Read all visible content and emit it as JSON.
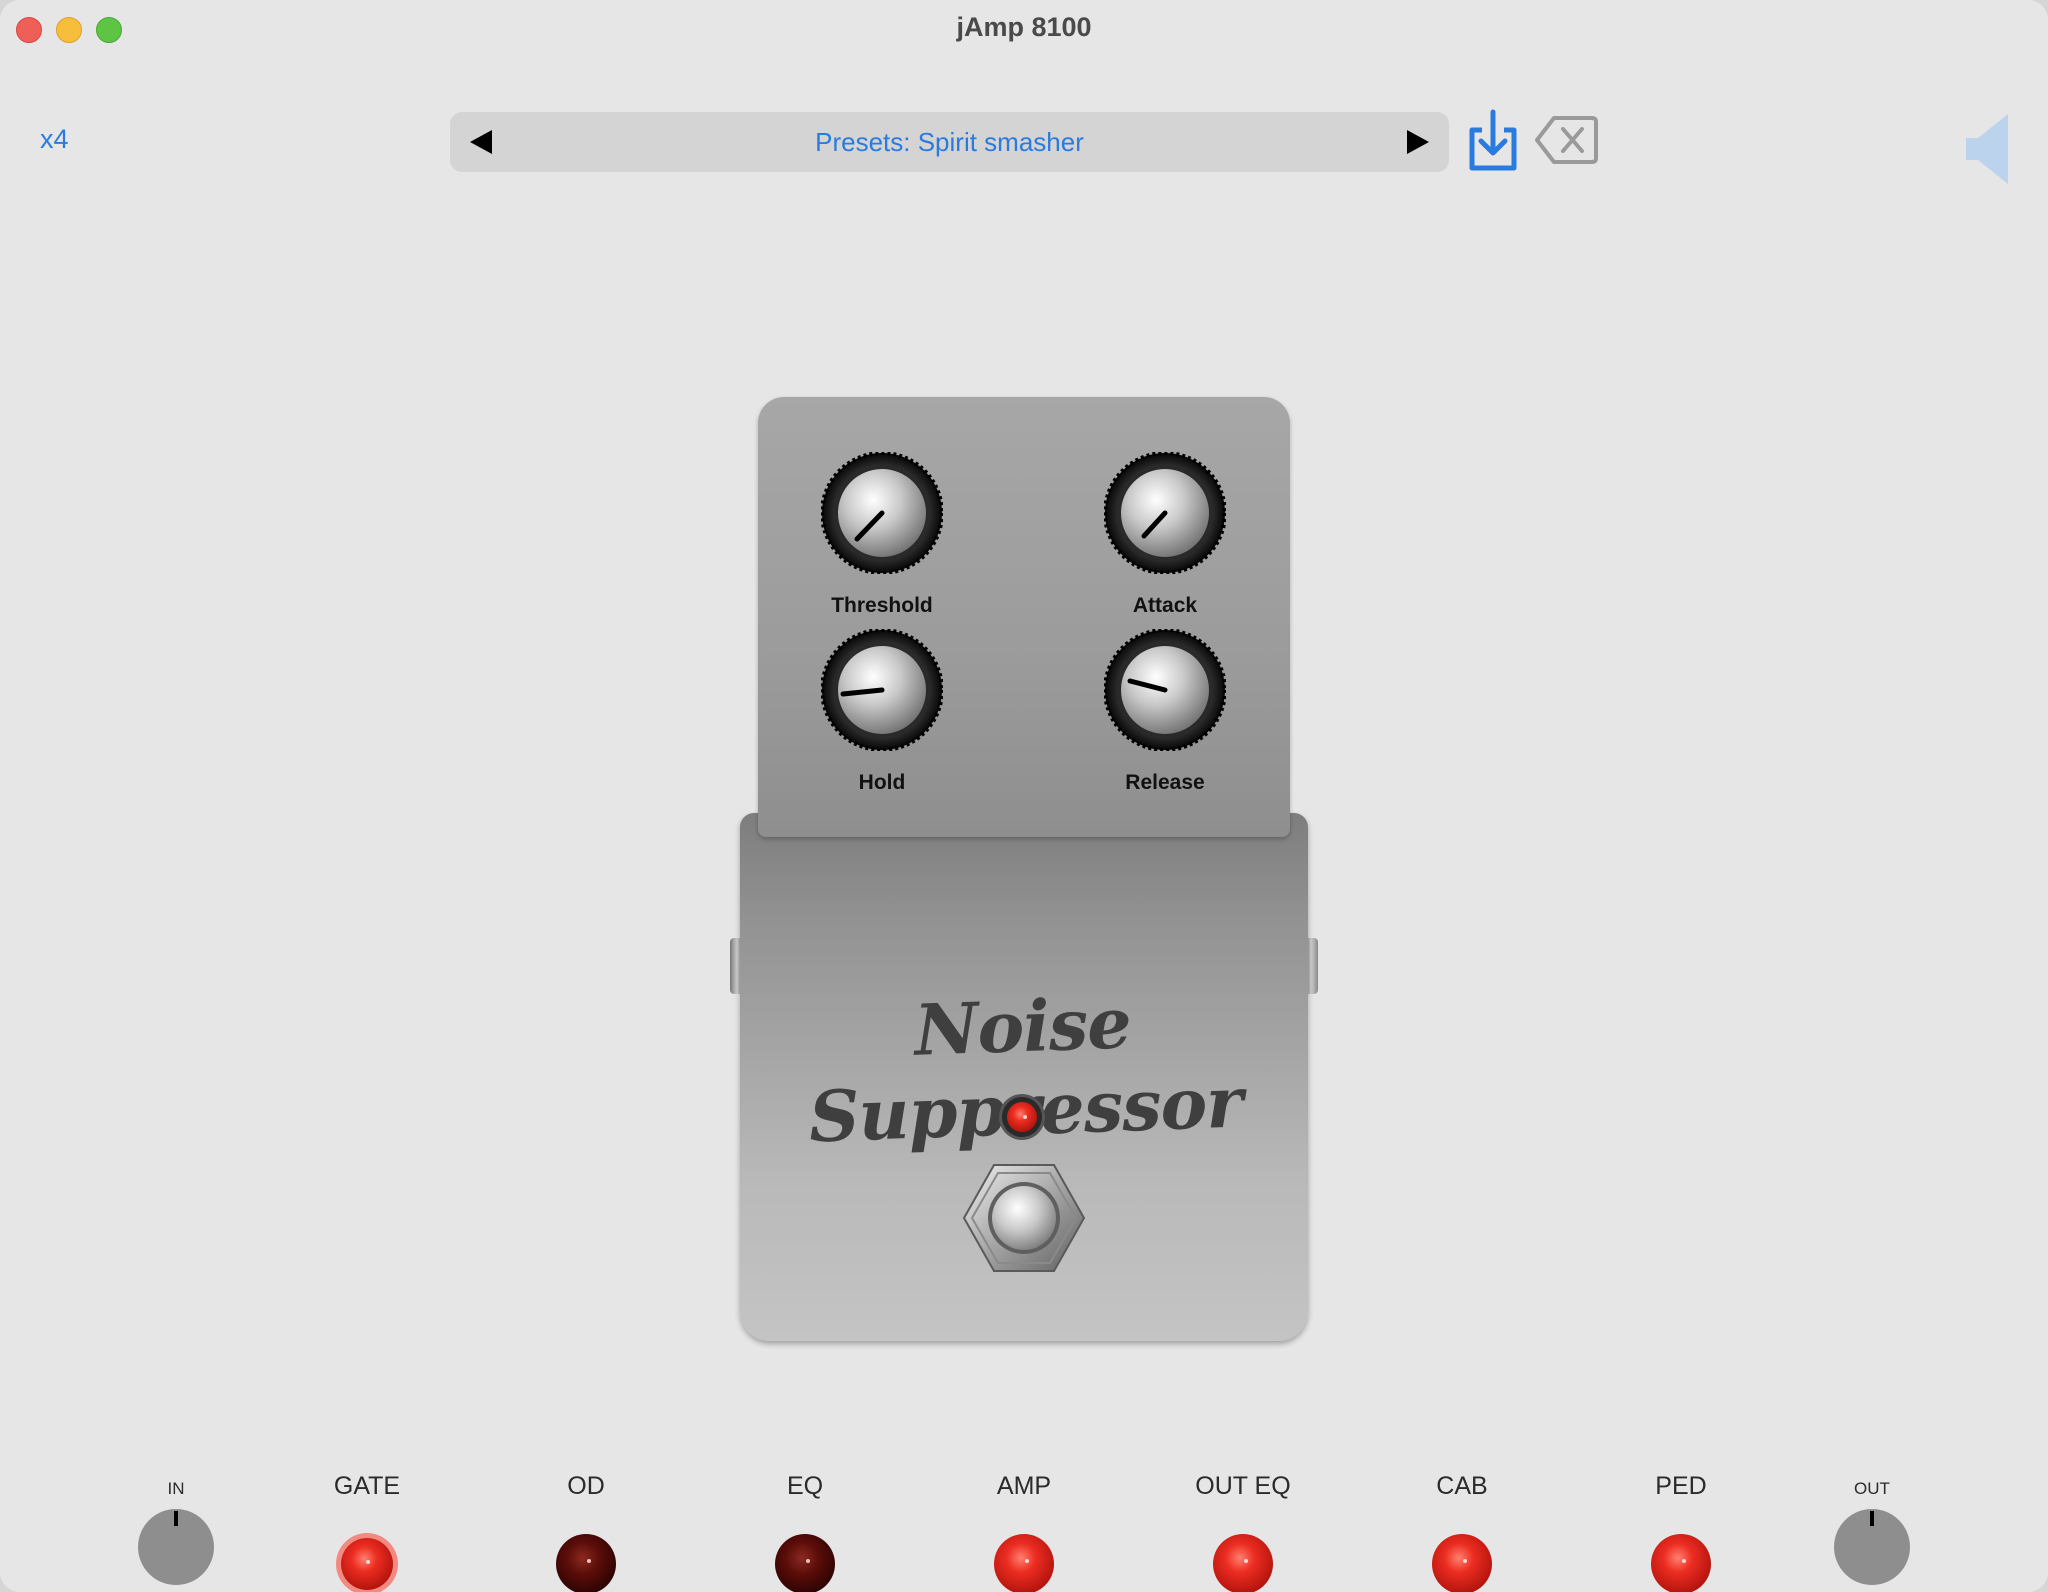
{
  "window": {
    "title": "jAmp 8100"
  },
  "toolbar": {
    "zoom_label": "x4",
    "preset_label": "Presets: Spirit smasher",
    "prev_icon": "triangle-left-icon",
    "next_icon": "triangle-right-icon",
    "save_icon": "download-tray-icon",
    "delete_icon": "delete-backspace-icon",
    "speaker_icon": "speaker-icon",
    "accent_color": "#2a7be0"
  },
  "pedal": {
    "name": "Noise Suppressor",
    "knobs": [
      {
        "label": "Threshold"
      },
      {
        "label": "Attack"
      },
      {
        "label": "Hold"
      },
      {
        "label": "Release"
      }
    ],
    "led_color": "#e8281e"
  },
  "signal_chain": {
    "input_label": "IN",
    "output_label": "OUT",
    "modules": [
      {
        "label": "GATE"
      },
      {
        "label": "OD"
      },
      {
        "label": "EQ"
      },
      {
        "label": "AMP"
      },
      {
        "label": "OUT EQ"
      },
      {
        "label": "CAB"
      },
      {
        "label": "PED"
      }
    ],
    "on_color": "#e8281e",
    "off_color": "#5a0a0a"
  }
}
